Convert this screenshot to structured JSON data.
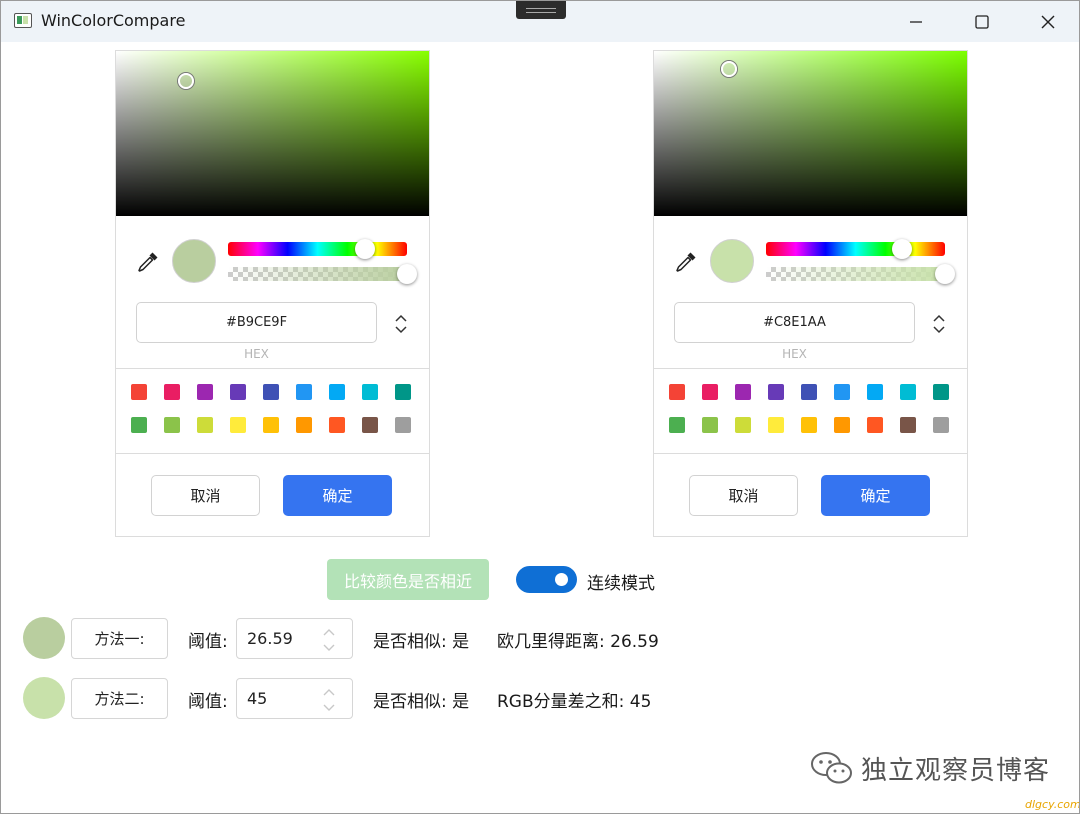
{
  "window": {
    "title": "WinColorCompare"
  },
  "pickers": [
    {
      "hue_color": "#88ff00",
      "color": "#B9CE9F",
      "hex_value": "#B9CE9F",
      "hex_label": "HEX",
      "cancel_label": "取消",
      "ok_label": "确定"
    },
    {
      "hue_color": "#7cff00",
      "color": "#C8E1AA",
      "hex_value": "#C8E1AA",
      "hex_label": "HEX",
      "cancel_label": "取消",
      "ok_label": "确定"
    }
  ],
  "swatch_colors": [
    [
      "#f44336",
      "#e91e63",
      "#9c27b0",
      "#673ab7",
      "#3f51b5",
      "#2196f3",
      "#03a9f4",
      "#00bcd4",
      "#009688"
    ],
    [
      "#4caf50",
      "#8bc34a",
      "#cddc39",
      "#ffeb3b",
      "#ffc107",
      "#ff9800",
      "#ff5722",
      "#795548",
      "#9e9e9e"
    ]
  ],
  "compare": {
    "button_label": "比较颜色是否相近",
    "toggle_label": "连续模式",
    "toggle_on": true
  },
  "methods": [
    {
      "swatch_color": "#B9CE9F",
      "label": "方法一:",
      "threshold_label": "阈值:",
      "threshold_value": "26.59",
      "similar_label": "是否相似: 是",
      "metric_label": "欧几里得距离: 26.59"
    },
    {
      "swatch_color": "#C8E1AA",
      "label": "方法二:",
      "threshold_label": "阈值:",
      "threshold_value": "45",
      "similar_label": "是否相似: 是",
      "metric_label": "RGB分量差之和: 45"
    }
  ],
  "watermark": {
    "text": "独立观察员博客",
    "site": "dlgcy.com"
  },
  "accent": "#3574f0"
}
